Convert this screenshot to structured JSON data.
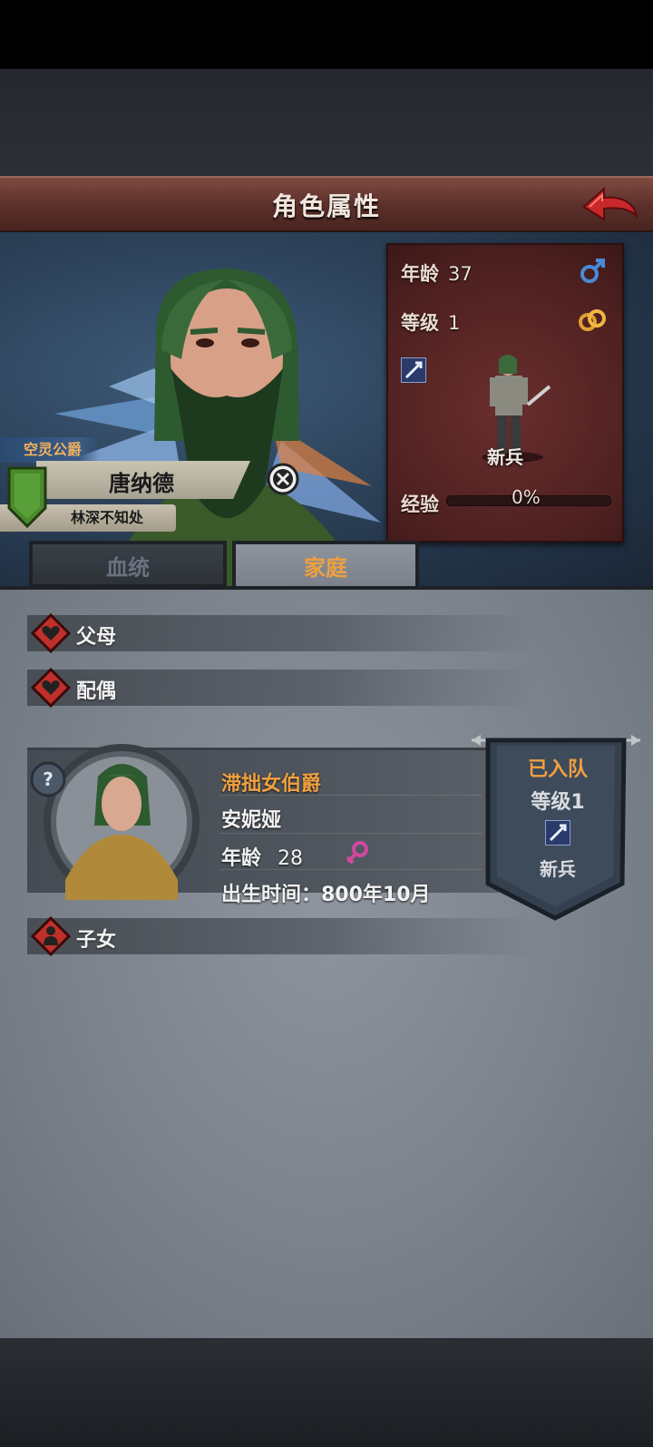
{
  "header": {
    "title": "角色属性"
  },
  "character": {
    "title": "空灵公爵",
    "name": "唐纳德",
    "home": "林深不知处"
  },
  "stats": {
    "age_label": "年龄",
    "age": "37",
    "level_label": "等级",
    "level": "1",
    "class": "新兵",
    "exp_label": "经验",
    "exp_percent": "0%",
    "exp_fraction": 0
  },
  "tabs": [
    {
      "label": "血统",
      "active": false
    },
    {
      "label": "家庭",
      "active": true
    }
  ],
  "family": {
    "parents_label": "父母",
    "spouse_label": "配偶",
    "children_label": "子女",
    "spouse": {
      "title": "滞拙女伯爵",
      "name": "安妮娅",
      "age_label": "年龄",
      "age": "28",
      "birth": "出生时间：800年10月",
      "status": "已入队",
      "level": "等级1",
      "class": "新兵"
    }
  },
  "colors": {
    "header": "#5a2f2a",
    "accent_orange": "#f0a040",
    "panel_grey": "#767d86",
    "stats_panel": "#4e2020"
  }
}
